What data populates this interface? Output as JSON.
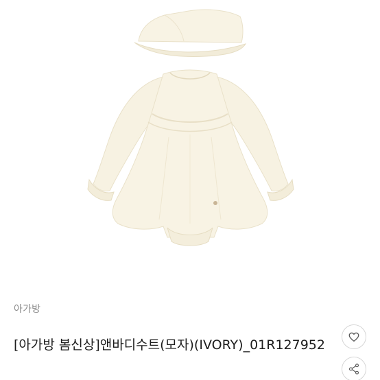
{
  "product": {
    "brand": "아가방",
    "title": "[아가방 봄신상]앤바디수트(모자)(IVORY)_01R127952",
    "image_alt": "ivory baby bodysuit with hat"
  },
  "actions": {
    "like_icon": "heart-icon",
    "share_icon": "share-icon"
  },
  "colors": {
    "garment": "#f7f2e2",
    "garment_shade": "#ece4cd",
    "text_primary": "#1c1c1c",
    "text_secondary": "#8b8b8b",
    "icon": "#5a5a5a"
  }
}
